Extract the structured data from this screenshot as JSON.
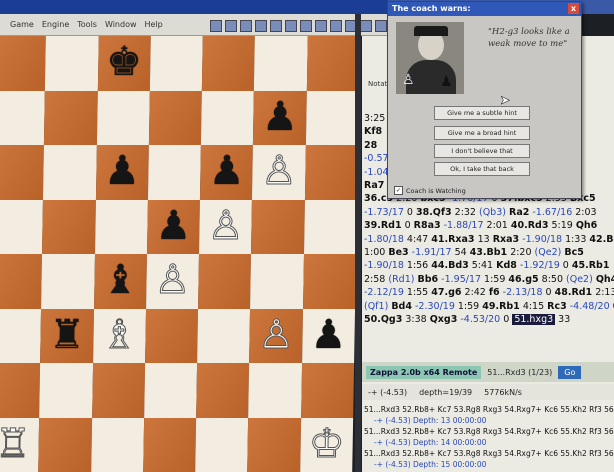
{
  "window": {
    "menu": [
      "Game",
      "Engine",
      "Tools",
      "Window",
      "Help"
    ]
  },
  "board": {
    "squares": [
      [
        "d",
        "l",
        "d",
        "l",
        "d",
        "l",
        "d"
      ],
      [
        "l",
        "d",
        "l",
        "d",
        "l",
        "d",
        "l"
      ],
      [
        "d",
        "l",
        "d",
        "l",
        "d",
        "l",
        "d"
      ],
      [
        "l",
        "d",
        "l",
        "d",
        "l",
        "d",
        "l"
      ],
      [
        "d",
        "l",
        "d",
        "l",
        "d",
        "l",
        "d"
      ],
      [
        "l",
        "d",
        "l",
        "d",
        "l",
        "d",
        "l"
      ],
      [
        "d",
        "l",
        "d",
        "l",
        "d",
        "l",
        "d"
      ],
      [
        "l",
        "d",
        "l",
        "d",
        "l",
        "d",
        "l"
      ]
    ],
    "pieces": [
      {
        "row": 0,
        "col": 2,
        "glyph": "♚",
        "color": "b",
        "name": "black-king"
      },
      {
        "row": 1,
        "col": 5,
        "glyph": "♟",
        "color": "b",
        "name": "black-pawn"
      },
      {
        "row": 2,
        "col": 2,
        "glyph": "♟",
        "color": "b",
        "name": "black-pawn"
      },
      {
        "row": 2,
        "col": 4,
        "glyph": "♟",
        "color": "b",
        "name": "black-pawn"
      },
      {
        "row": 2,
        "col": 5,
        "glyph": "♙",
        "color": "w",
        "name": "white-pawn"
      },
      {
        "row": 3,
        "col": 3,
        "glyph": "♟",
        "color": "b",
        "name": "black-pawn"
      },
      {
        "row": 3,
        "col": 4,
        "glyph": "♙",
        "color": "w",
        "name": "white-pawn"
      },
      {
        "row": 4,
        "col": 2,
        "glyph": "♝",
        "color": "b",
        "name": "black-bishop"
      },
      {
        "row": 4,
        "col": 3,
        "glyph": "♙",
        "color": "w",
        "name": "white-pawn"
      },
      {
        "row": 5,
        "col": 1,
        "glyph": "♜",
        "color": "b",
        "name": "black-rook"
      },
      {
        "row": 5,
        "col": 2,
        "glyph": "♗",
        "color": "w",
        "name": "white-bishop"
      },
      {
        "row": 5,
        "col": 5,
        "glyph": "♙",
        "color": "w",
        "name": "white-pawn"
      },
      {
        "row": 5,
        "col": 6,
        "glyph": "♟",
        "color": "b",
        "name": "black-pawn"
      },
      {
        "row": 7,
        "col": 0,
        "glyph": "♖",
        "color": "w",
        "name": "white-rook"
      },
      {
        "row": 7,
        "col": 6,
        "glyph": "♔",
        "color": "w",
        "name": "white-king"
      }
    ]
  },
  "coach": {
    "title": "The coach warns:",
    "close": "x",
    "quote": "\"H2-g3 looks like a weak move to me\"",
    "buttons": [
      "Give me a subtle hint",
      "Give me a broad hint",
      "I don't believe that",
      "Ok, I take that back"
    ],
    "watching_label": "Coach is Watching",
    "watching_checked": "✓"
  },
  "notation": {
    "tab": "Notatio",
    "rows": [
      [
        {
          "t": "3:25"
        }
      ],
      [
        {
          "t": "Kf8",
          "c": "mv"
        }
      ],
      [
        {
          "t": "28",
          "c": "mv"
        }
      ],
      [
        {
          "t": "-0.57",
          "c": "ev"
        }
      ],
      [
        {
          "t": "-1.04",
          "c": "ev"
        }
      ],
      [
        {
          "t": "Ra7",
          "c": "mv"
        }
      ],
      [
        {
          "t": "36.c5",
          "c": "mv"
        },
        {
          "t": " 2:20 "
        },
        {
          "t": "bxc5",
          "c": "mv"
        },
        {
          "t": " -1.76/17",
          "c": "ev"
        },
        {
          "t": " 0 "
        },
        {
          "t": "37.bxc5",
          "c": "mv"
        },
        {
          "t": " 2:55 "
        },
        {
          "t": "Bxc5",
          "c": "mv"
        }
      ],
      [
        {
          "t": "-1.73/17",
          "c": "ev"
        },
        {
          "t": " 0 "
        },
        {
          "t": "38.Qf3",
          "c": "mv"
        },
        {
          "t": " 2:32 "
        },
        {
          "t": "(Qb3)",
          "c": "ev"
        },
        {
          "t": " "
        },
        {
          "t": "Ra2",
          "c": "mv"
        },
        {
          "t": " -1.67/16",
          "c": "ev"
        },
        {
          "t": " 2:03"
        }
      ],
      [
        {
          "t": "39.Rd1",
          "c": "mv"
        },
        {
          "t": " 0 "
        },
        {
          "t": "R8a3",
          "c": "mv"
        },
        {
          "t": " -1.88/17",
          "c": "ev"
        },
        {
          "t": " 2:01 "
        },
        {
          "t": "40.Rd3",
          "c": "mv"
        },
        {
          "t": " 5:19 "
        },
        {
          "t": "Qh6",
          "c": "mv"
        }
      ],
      [
        {
          "t": "-1.80/18",
          "c": "ev"
        },
        {
          "t": " 4:47 "
        },
        {
          "t": "41.Rxa3",
          "c": "mv"
        },
        {
          "t": " 13 "
        },
        {
          "t": "Rxa3",
          "c": "mv"
        },
        {
          "t": " -1.90/18",
          "c": "ev"
        },
        {
          "t": " 1:33 "
        },
        {
          "t": "42.Bd3",
          "c": "mv"
        }
      ],
      [
        {
          "t": "1:00 "
        },
        {
          "t": "Be3",
          "c": "mv"
        },
        {
          "t": " -1.91/17",
          "c": "ev"
        },
        {
          "t": " 54 "
        },
        {
          "t": "43.Bb1",
          "c": "mv"
        },
        {
          "t": " 2:20 "
        },
        {
          "t": "(Qe2)",
          "c": "ev"
        },
        {
          "t": " "
        },
        {
          "t": "Bc5",
          "c": "mv"
        }
      ],
      [
        {
          "t": "-1.90/18",
          "c": "ev"
        },
        {
          "t": " 1:56 "
        },
        {
          "t": "44.Bd3",
          "c": "mv"
        },
        {
          "t": " 5:41 "
        },
        {
          "t": "Kd8",
          "c": "mv"
        },
        {
          "t": " -1.92/19",
          "c": "ev"
        },
        {
          "t": " 0 "
        },
        {
          "t": "45.Rb1",
          "c": "mv"
        }
      ],
      [
        {
          "t": "2:58 "
        },
        {
          "t": "(Rd1)",
          "c": "ev"
        },
        {
          "t": " "
        },
        {
          "t": "Bb6",
          "c": "mv"
        },
        {
          "t": " -1.95/17",
          "c": "ev"
        },
        {
          "t": " 1:59 "
        },
        {
          "t": "46.g5",
          "c": "mv"
        },
        {
          "t": " 8:50 "
        },
        {
          "t": "(Qe2)",
          "c": "ev"
        },
        {
          "t": " "
        },
        {
          "t": "Qh4",
          "c": "mv"
        }
      ],
      [
        {
          "t": "-2.12/19",
          "c": "ev"
        },
        {
          "t": " 1:55 "
        },
        {
          "t": "47.g6",
          "c": "mv"
        },
        {
          "t": " 2:42 "
        },
        {
          "t": "f6",
          "c": "mv"
        },
        {
          "t": " -2.13/18",
          "c": "ev"
        },
        {
          "t": " 0 "
        },
        {
          "t": "48.Rd1",
          "c": "mv"
        },
        {
          "t": " 2:13"
        }
      ],
      [
        {
          "t": "(Qf1)",
          "c": "ev"
        },
        {
          "t": " "
        },
        {
          "t": "Bd4",
          "c": "mv"
        },
        {
          "t": " -2.30/19",
          "c": "ev"
        },
        {
          "t": " 1:59 "
        },
        {
          "t": "49.Rb1",
          "c": "mv"
        },
        {
          "t": " 4:15 "
        },
        {
          "t": "Rc3",
          "c": "mv"
        },
        {
          "t": " -4.48/20",
          "c": "ev"
        },
        {
          "t": " 0"
        }
      ],
      [
        {
          "t": "50.Qg3",
          "c": "mv"
        },
        {
          "t": " 3:38 "
        },
        {
          "t": "Qxg3",
          "c": "mv"
        },
        {
          "t": " -4.53/20",
          "c": "ev"
        },
        {
          "t": " 0 "
        },
        {
          "t": "51.hxg3",
          "c": "hl"
        },
        {
          "t": " 33"
        }
      ]
    ]
  },
  "engine": {
    "name": "Zappa 2.0b x64 Remote",
    "move": "51...Rxd3 (1/23)",
    "go": "Go",
    "eval": "-+ (-4.53)",
    "depth": "depth=19/39",
    "speed": "5776kN/s",
    "pv": [
      {
        "t": "51...Rxd3 52.Rb8+ Kc7 53.Rg8 Rxg3 54.Rxg7+ Kc6 55.Kh2 Rf3 56.Rf7"
      },
      {
        "t": "-+ (-4.53)   Depth: 13   00:00:00",
        "c": "sub"
      },
      {
        "t": "51...Rxd3 52.Rb8+ Kc7 53.Rg8 Rxg3 54.Rxg7+ Kc6 55.Kh2 Rf3 56.Rf7"
      },
      {
        "t": "-+ (-4.53)   Depth: 14   00:00:00",
        "c": "sub"
      },
      {
        "t": "51...Rxd3 52.Rb8+ Kc7 53.Rg8 Rxg3 54.Rxg7+ Kc6 55.Kh2 Rf3 56.Rf7"
      },
      {
        "t": "-+ (-4.53)   Depth: 15   00:00:00",
        "c": "sub"
      }
    ]
  }
}
